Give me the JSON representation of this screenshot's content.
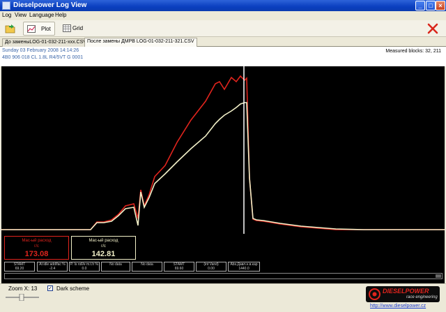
{
  "window": {
    "title": "Dieselpower Log View"
  },
  "menu": [
    "Log",
    "View",
    "Language",
    "Help"
  ],
  "toolbar": {
    "plot_label": "Plot",
    "grid_label": "Grid"
  },
  "tabs": [
    {
      "label": "До заменыLOG-01-032-211-xxx.CSV",
      "active": false
    },
    {
      "label": "После замены ДМРВ LOG-01-032-211-321.CSV",
      "active": true
    }
  ],
  "info": {
    "date": "Sunday 03 February 2008 14:14:26",
    "ecu": "4B0 906 018 CL  1.8L R4/5VT     G   0001",
    "measured_blocks": "Measured blocks: 32, 211"
  },
  "readouts": [
    {
      "label": "Мас-ый расход",
      "unit": "г/с",
      "value": "173.08",
      "color": "#e0241d"
    },
    {
      "label": "Мас-ый расход",
      "unit": "г/с",
      "value": "142.81",
      "color": "#f2f0c8"
    }
  ],
  "channels": [
    {
      "label": "STAMT",
      "value": "69.20"
    },
    {
      "label": "At idle add/fac %",
      "value": "-2.4"
    },
    {
      "label": "P. Is roll/e m.t.h %",
      "value": "0.0"
    },
    {
      "label": "No data",
      "value": ""
    },
    {
      "label": "No data",
      "value": ""
    },
    {
      "label": "STAMT",
      "value": "69.60"
    },
    {
      "label": "(int Vand)",
      "value": "0.00"
    },
    {
      "label": "Abs.Давл.н.в.кар",
      "value": "1440.0"
    }
  ],
  "bottom": {
    "zoom_label": "Zoom X: 13",
    "dark_scheme_label": "Dark scheme",
    "dark_scheme_checked": true,
    "brand": "DIESELPOWER",
    "brand_sub": "race engineering",
    "url": "http://www.dieselpower.cz"
  },
  "chart_data": {
    "type": "line",
    "grid": false,
    "cursor_x": 348,
    "series": [
      {
        "color": "#e0241d",
        "x": [
          0,
          120,
          128,
          137,
          147,
          158,
          168,
          178,
          190,
          196,
          200,
          205,
          212,
          220,
          235,
          252,
          272,
          293,
          307,
          313,
          320,
          330,
          337,
          343,
          349,
          352,
          356,
          361,
          366,
          376,
          400,
          430,
          480,
          520,
          560,
          600,
          636
        ],
        "y": [
          6,
          6,
          6,
          17,
          17,
          20,
          28,
          40,
          43,
          22,
          63,
          40,
          56,
          82,
          98,
          131,
          163,
          190,
          215,
          218,
          207,
          224,
          218,
          226,
          220,
          223,
          80,
          21,
          19,
          18,
          14,
          10,
          6,
          6,
          6,
          6,
          6
        ]
      },
      {
        "color": "#f2f0c8",
        "x": [
          0,
          120,
          128,
          137,
          147,
          158,
          168,
          178,
          190,
          196,
          200,
          205,
          212,
          220,
          235,
          252,
          272,
          293,
          307,
          313,
          320,
          330,
          337,
          343,
          349,
          352,
          356,
          361,
          366,
          376,
          400,
          430,
          480,
          520,
          560,
          600,
          636
        ],
        "y": [
          6,
          6,
          6,
          16,
          16,
          18,
          26,
          36,
          38,
          12,
          60,
          38,
          52,
          72,
          86,
          103,
          122,
          140,
          158,
          164,
          170,
          176,
          181,
          186,
          188,
          188,
          80,
          22,
          20,
          19,
          15,
          11,
          7,
          6,
          6,
          6,
          6
        ]
      }
    ]
  }
}
